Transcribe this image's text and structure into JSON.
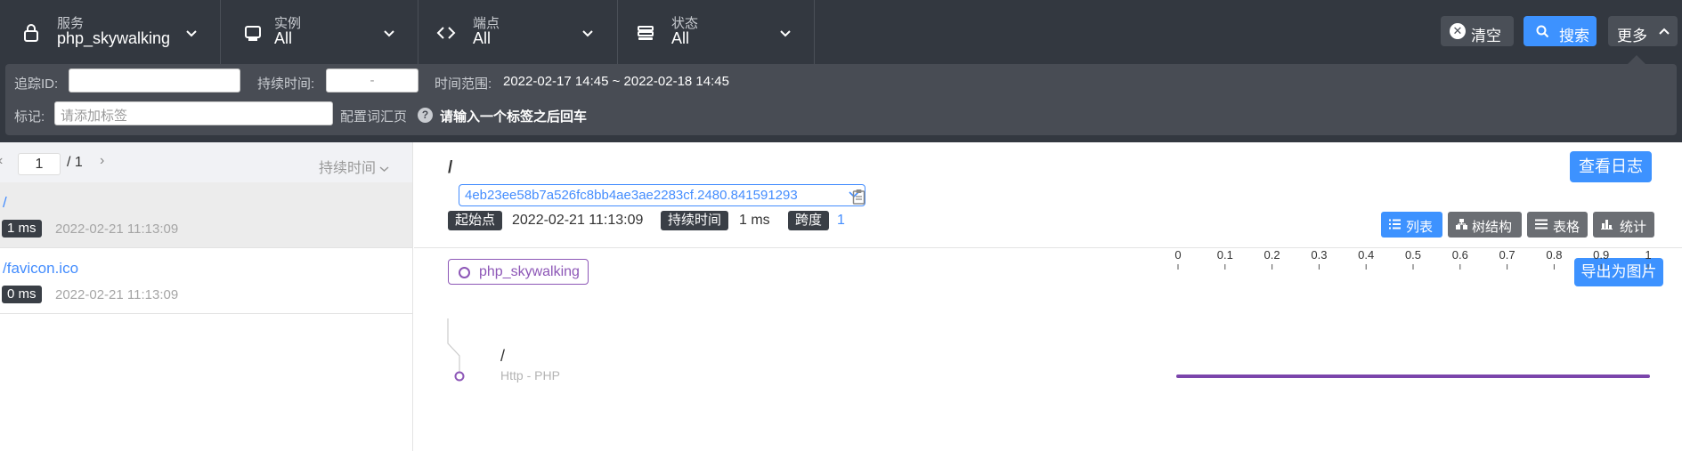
{
  "filters": [
    {
      "title": "服务",
      "value": "php_skywalking",
      "icon": "lock-icon"
    },
    {
      "title": "实例",
      "value": "All",
      "icon": "server-icon"
    },
    {
      "title": "端点",
      "value": "All",
      "icon": "code-icon"
    },
    {
      "title": "状态",
      "value": "All",
      "icon": "stack-icon"
    }
  ],
  "actions": {
    "clear": "清空",
    "search": "搜索",
    "more": "更多"
  },
  "more": {
    "trace_id_label": "追踪ID:",
    "trace_id_value": "",
    "duration_label": "持续时间:",
    "duration_placeholder": "-",
    "range_label": "时间范围:",
    "range_value": "2022-02-17 14:45 ~ 2022-02-18 14:45",
    "tags_label": "标记:",
    "tags_placeholder": "请添加标签",
    "config_label": "配置词汇页",
    "tags_hint": "请输入一个标签之后回车"
  },
  "list": {
    "page": "1",
    "total": "/ 1",
    "sort_label": "持续时间",
    "items": [
      {
        "endpoint": "/",
        "duration": "1 ms",
        "time": "2022-02-21 11:13:09"
      },
      {
        "endpoint": "/favicon.ico",
        "duration": "0 ms",
        "time": "2022-02-21 11:13:09"
      }
    ]
  },
  "detail": {
    "title": "/",
    "trace_id": "4eb23ee58b7a526fc8bb4ae3ae2283cf.2480.841591293",
    "start_label": "起始点",
    "start_value": "2022-02-21 11:13:09",
    "duration_label": "持续时间",
    "duration_value": "1 ms",
    "span_label": "跨度",
    "span_value": "1",
    "view_logs": "查看日志",
    "views": [
      "列表",
      "树结构",
      "表格",
      "统计"
    ],
    "active_view": "列表",
    "service": "php_skywalking",
    "export": "导出为图片",
    "axis_ticks": [
      "0",
      "0.1",
      "0.2",
      "0.3",
      "0.4",
      "0.5",
      "0.6",
      "0.7",
      "0.8",
      "0.9",
      "1"
    ],
    "span": {
      "name": "/",
      "layer": "Http - PHP",
      "start": 0,
      "end": 1
    }
  },
  "colors": {
    "accent": "#3d92ff",
    "service": "#8d57b7",
    "header": "#333840"
  }
}
